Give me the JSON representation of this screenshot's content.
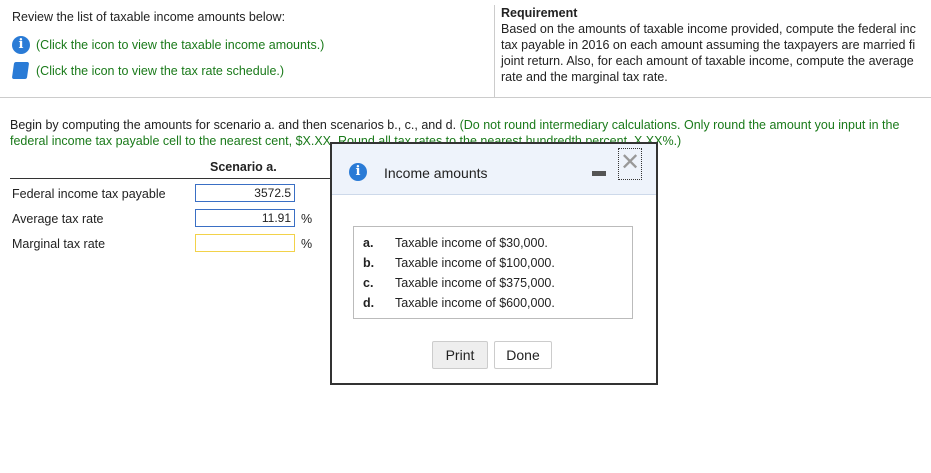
{
  "left": {
    "prompt": "Review the list of taxable income amounts below:",
    "link1": "(Click the icon to view the taxable income amounts.)",
    "link2": "(Click the icon to view the tax rate schedule.)"
  },
  "requirement": {
    "title": "Requirement",
    "lines": [
      "Based on the amounts of taxable income provided, compute the federal inc",
      "tax payable in 2016 on each amount assuming the taxpayers are married fi",
      "joint return. Also, for each amount of taxable income, compute the average",
      "rate and the marginal tax rate."
    ]
  },
  "instructions": {
    "main": "Begin by computing the amounts for scenario a. and then scenarios b., c., and d.",
    "note1": "(Do not round intermediary calculations. Only round the amount you input in the",
    "note2": "federal income tax payable cell to the nearest cent, $X.XX. Round all tax rates to the nearest hundredth percent, X.XX%.)"
  },
  "table": {
    "column": "Scenario a.",
    "rows": [
      {
        "label": "Federal income tax payable",
        "value": "3572.5",
        "suffix": ""
      },
      {
        "label": "Average tax rate",
        "value": "11.91",
        "suffix": "%"
      },
      {
        "label": "Marginal tax rate",
        "value": "",
        "suffix": "%"
      }
    ]
  },
  "dialog": {
    "title": "Income amounts",
    "items": [
      {
        "letter": "a.",
        "text": "Taxable income of $30,000."
      },
      {
        "letter": "b.",
        "text": "Taxable income of $100,000."
      },
      {
        "letter": "c.",
        "text": "Taxable income of $375,000."
      },
      {
        "letter": "d.",
        "text": "Taxable income of $600,000."
      }
    ],
    "print": "Print",
    "done": "Done"
  }
}
